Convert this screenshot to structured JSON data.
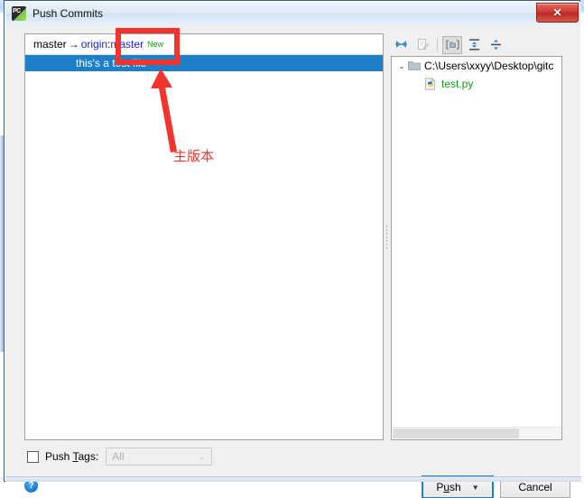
{
  "window": {
    "title": "Push Commits",
    "app_icon": "pycharm-icon",
    "close_label": "✕"
  },
  "commit_pane": {
    "header": {
      "local_branch": "master",
      "arrow": "→",
      "remote": "origin",
      "separator": ":",
      "remote_branch": "master",
      "new_badge": "New"
    },
    "commits": [
      {
        "message": "this's a test file",
        "selected": true
      }
    ]
  },
  "files_pane": {
    "toolbar": [
      {
        "name": "collapse-selection-icon",
        "enabled": true,
        "pressed": false
      },
      {
        "name": "edit-document-icon",
        "enabled": false,
        "pressed": false
      },
      {
        "name": "group-by-directory-icon",
        "enabled": true,
        "pressed": true
      },
      {
        "name": "expand-all-icon",
        "enabled": true,
        "pressed": false
      },
      {
        "name": "collapse-all-icon",
        "enabled": true,
        "pressed": false
      }
    ],
    "tree": {
      "directory": {
        "label": "C:\\Users\\xxyy\\Desktop\\gitc",
        "expanded": true,
        "chevron": "⌄"
      },
      "files": [
        {
          "label": "test.py",
          "icon": "python-file-icon"
        }
      ]
    }
  },
  "push_tags": {
    "checkbox_checked": false,
    "label_before": "Push ",
    "label_mnemonic": "T",
    "label_after": "ags:",
    "combo_value": "All",
    "combo_enabled": false,
    "combo_chevron": "⌄"
  },
  "help": {
    "glyph": "?"
  },
  "buttons": {
    "push_before": "P",
    "push_mnemonic": "u",
    "push_after": "sh",
    "push_arrow": "▼",
    "cancel": "Cancel"
  },
  "annotation": {
    "text": "主版本",
    "color": "#f3332e"
  },
  "colors": {
    "selection_blue": "#1e7ec8",
    "remote_blue": "#1a1ae6",
    "new_green": "#189b18",
    "file_green": "#189b18",
    "annotation_red": "#f3332e",
    "close_red": "#cf3a31"
  }
}
